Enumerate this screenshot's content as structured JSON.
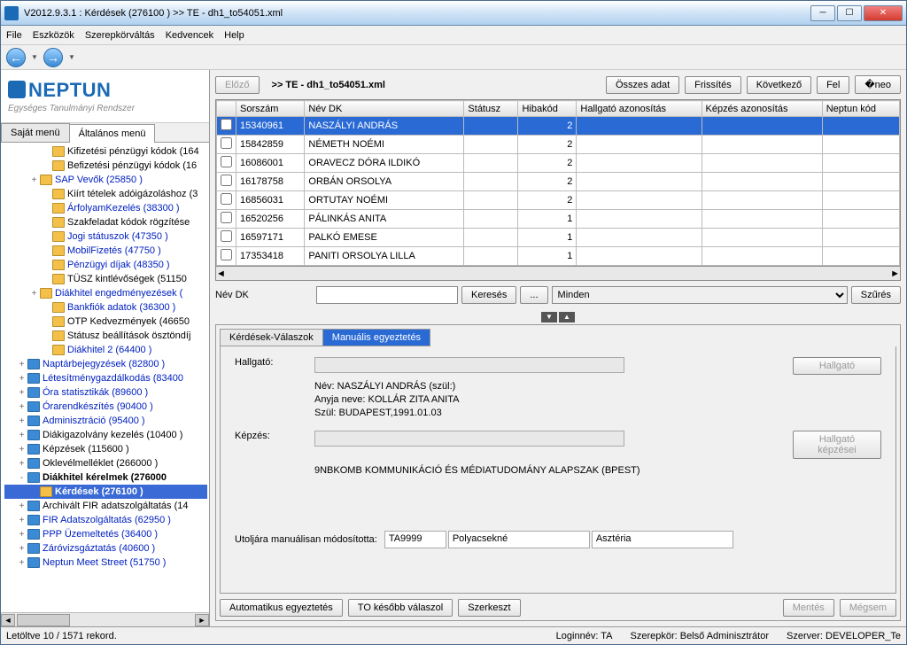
{
  "window": {
    "title": "V2012.9.3.1 : Kérdések (276100 )  >> TE - dh1_to54051.xml"
  },
  "menu": [
    "File",
    "Eszközök",
    "Szerepkörváltás",
    "Kedvencek",
    "Help"
  ],
  "logo": {
    "main": "NEPTUN",
    "sub": "Egységes Tanulmányi Rendszer"
  },
  "leftTabs": {
    "t1": "Saját menü",
    "t2": "Általános menü"
  },
  "tree": [
    {
      "ind": 3,
      "ico": "y",
      "lbl": "Kifizetési pénzügyi kódok (164"
    },
    {
      "ind": 3,
      "ico": "y",
      "lbl": "Befizetési pénzügyi kódok (16"
    },
    {
      "ind": 2,
      "tw": "+",
      "ico": "y",
      "link": true,
      "lbl": "SAP Vevők (25850 )"
    },
    {
      "ind": 3,
      "ico": "y",
      "lbl": "Kiírt tételek adóigázoláshoz (3"
    },
    {
      "ind": 3,
      "ico": "y",
      "link": true,
      "lbl": "ÁrfolyamKezelés (38300 )"
    },
    {
      "ind": 3,
      "ico": "y",
      "lbl": "Szakfeladat kódok rögzítése"
    },
    {
      "ind": 3,
      "ico": "y",
      "link": true,
      "lbl": "Jogi státuszok (47350 )"
    },
    {
      "ind": 3,
      "ico": "y",
      "link": true,
      "lbl": "MobilFizetés (47750 )"
    },
    {
      "ind": 3,
      "ico": "y",
      "link": true,
      "lbl": "Pénzügyi díjak (48350 )"
    },
    {
      "ind": 3,
      "ico": "y",
      "lbl": "TÜSZ kintlévőségek (51150"
    },
    {
      "ind": 2,
      "tw": "+",
      "ico": "y",
      "link": true,
      "lbl": "Diákhitel engedményezések ("
    },
    {
      "ind": 3,
      "ico": "y",
      "link": true,
      "lbl": "Bankfiók adatok (36300 )"
    },
    {
      "ind": 3,
      "ico": "y",
      "lbl": "OTP Kedvezmények (46650"
    },
    {
      "ind": 3,
      "ico": "y",
      "lbl": "Státusz beállítások ösztöndíj"
    },
    {
      "ind": 3,
      "ico": "y",
      "link": true,
      "lbl": "Diákhitel 2 (64400 )"
    },
    {
      "ind": 1,
      "tw": "+",
      "ico": "b",
      "link": true,
      "lbl": "Naptárbejegyzések (82800 )"
    },
    {
      "ind": 1,
      "tw": "+",
      "ico": "b",
      "link": true,
      "lbl": "Létesítménygazdálkodás (83400"
    },
    {
      "ind": 1,
      "tw": "+",
      "ico": "b",
      "link": true,
      "lbl": "Óra statisztikák (89600 )"
    },
    {
      "ind": 1,
      "tw": "+",
      "ico": "b",
      "link": true,
      "lbl": "Órarendkészítés (90400 )"
    },
    {
      "ind": 1,
      "tw": "+",
      "ico": "b",
      "link": true,
      "lbl": "Adminisztráció (95400 )"
    },
    {
      "ind": 1,
      "tw": "+",
      "ico": "b",
      "lbl": "Diákigazolvány kezelés (10400 )"
    },
    {
      "ind": 1,
      "tw": "+",
      "ico": "b",
      "lbl": "Képzések (115600 )"
    },
    {
      "ind": 1,
      "tw": "+",
      "ico": "b",
      "lbl": "Oklevélmelléklet (266000 )"
    },
    {
      "ind": 1,
      "tw": "-",
      "ico": "b",
      "bold": true,
      "lbl": "Diákhitel kérelmek (276000"
    },
    {
      "ind": 2,
      "ico": "y",
      "sel": true,
      "lbl": "Kérdések (276100 )"
    },
    {
      "ind": 1,
      "tw": "+",
      "ico": "b",
      "lbl": "Archivált FIR adatszolgáltatás (14"
    },
    {
      "ind": 1,
      "tw": "+",
      "ico": "b",
      "link": true,
      "lbl": "FIR Adatszolgáltatás (62950 )"
    },
    {
      "ind": 1,
      "tw": "+",
      "ico": "b",
      "link": true,
      "lbl": "PPP Üzemeltetés (36400 )"
    },
    {
      "ind": 1,
      "tw": "+",
      "ico": "b",
      "link": true,
      "lbl": "Záróvizsgáztatás (40600 )"
    },
    {
      "ind": 1,
      "tw": "+",
      "ico": "b",
      "link": true,
      "lbl": "Neptun Meet Street (51750 )"
    }
  ],
  "rightHeader": {
    "prev": "Előző",
    "path": ">> TE - dh1_to54051.xml",
    "all": "Összes adat",
    "refresh": "Frissítés",
    "next": "Következő",
    "up": "Fel"
  },
  "grid": {
    "cols": [
      "",
      "Sorszám",
      "Név DK",
      "Státusz",
      "Hibakód",
      "Hallgató azonosítás",
      "Képzés azonosítás",
      "Neptun kód"
    ],
    "rows": [
      {
        "sel": true,
        "c1": "15340961",
        "c2": "NASZÁLYI ANDRÁS",
        "c4": "2"
      },
      {
        "c1": "15842859",
        "c2": "NÉMETH NOÉMI",
        "c4": "2"
      },
      {
        "c1": "16086001",
        "c2": "ORAVECZ DÓRA ILDIKÓ",
        "c4": "2"
      },
      {
        "c1": "16178758",
        "c2": "ORBÁN ORSOLYA",
        "c4": "2"
      },
      {
        "c1": "16856031",
        "c2": "ORTUTAY NOÉMI",
        "c4": "2"
      },
      {
        "c1": "16520256",
        "c2": "PÁLINKÁS ANITA",
        "c4": "1"
      },
      {
        "c1": "16597171",
        "c2": "PALKÓ EMESE",
        "c4": "1"
      },
      {
        "c1": "17353418",
        "c2": "PANITI ORSOLYA LILLA",
        "c4": "1"
      }
    ]
  },
  "filter": {
    "label": "Név DK",
    "search": "Keresés",
    "dots": "...",
    "all": "Minden",
    "szures": "Szűrés"
  },
  "dtabs": {
    "t1": "Kérdések-Válaszok",
    "t2": "Manuális egyeztetés"
  },
  "detail": {
    "hallgatoLbl": "Hallgató:",
    "hallgatoBtn": "Hallgató",
    "nevLine": "Név: NASZÁLYI ANDRÁS   (szül:)",
    "anyjaLine": "Anyja neve: KOLLÁR ZITA ANITA",
    "szulLine": "Szül:  BUDAPEST,1991.01.03",
    "kepzesLbl": "Képzés:",
    "kepzesBtn": "Hallgató képzései",
    "kepzesVal": "9NBKOMB KOMMUNIKÁCIÓ ÉS MÉDIATUDOMÁNY ALAPSZAK (BPEST)",
    "lastLbl": "Utoljára manuálisan módosította:",
    "u1": "TA9999",
    "u2": "Polyacsekné",
    "u3": "Asztéria"
  },
  "bottom": {
    "auto": "Automatikus egyeztetés",
    "later": "TO később válaszol",
    "edit": "Szerkeszt",
    "save": "Mentés",
    "cancel": "Mégsem"
  },
  "status": {
    "left": "Letöltve 10 / 1571 rekord.",
    "login": "Loginnév: TA",
    "role": "Szerepkör: Belső Adminisztrátor",
    "server": "Szerver: DEVELOPER_Te"
  }
}
